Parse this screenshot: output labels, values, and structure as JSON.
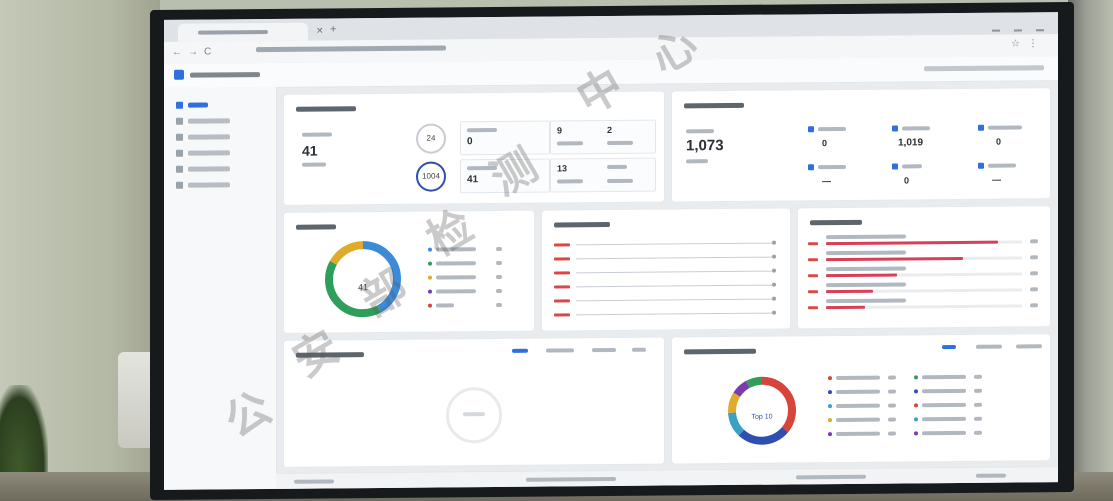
{
  "asset_panel": {
    "total": "41",
    "ring_a": "24",
    "ring_b": "1004",
    "stat_a": "0",
    "stat_b": "41",
    "stat_c": "9",
    "stat_d": "13",
    "stat_e": "2"
  },
  "status_panel": {
    "count": "1,073",
    "b": "1,019",
    "c": "0",
    "a": "0",
    "d": "0",
    "e": "—",
    "f": "—"
  },
  "donut": {
    "center_label": "41",
    "segments": [
      {
        "color": "#3d8bd8",
        "value": 0.42
      },
      {
        "color": "#2e9f5a",
        "value": 0.41
      },
      {
        "color": "#e0aa2a",
        "value": 0.17
      }
    ]
  },
  "donut2": {
    "center_label": "Top 10",
    "segments": [
      {
        "color": "#d7453a",
        "value": 0.36
      },
      {
        "color": "#2f4fb0",
        "value": 0.26
      },
      {
        "color": "#3aa0c4",
        "value": 0.12
      },
      {
        "color": "#e0aa2a",
        "value": 0.1
      },
      {
        "color": "#7a3ab0",
        "value": 0.08
      },
      {
        "color": "#2e9f5a",
        "value": 0.08
      }
    ]
  },
  "hbars": [
    0.88,
    0.7,
    0.36,
    0.24,
    0.2
  ],
  "watermark": {
    "c1": "公",
    "c2": "安",
    "c3": "部",
    "c4": "检",
    "c5": "测",
    "c6": "中",
    "c7": "心"
  }
}
